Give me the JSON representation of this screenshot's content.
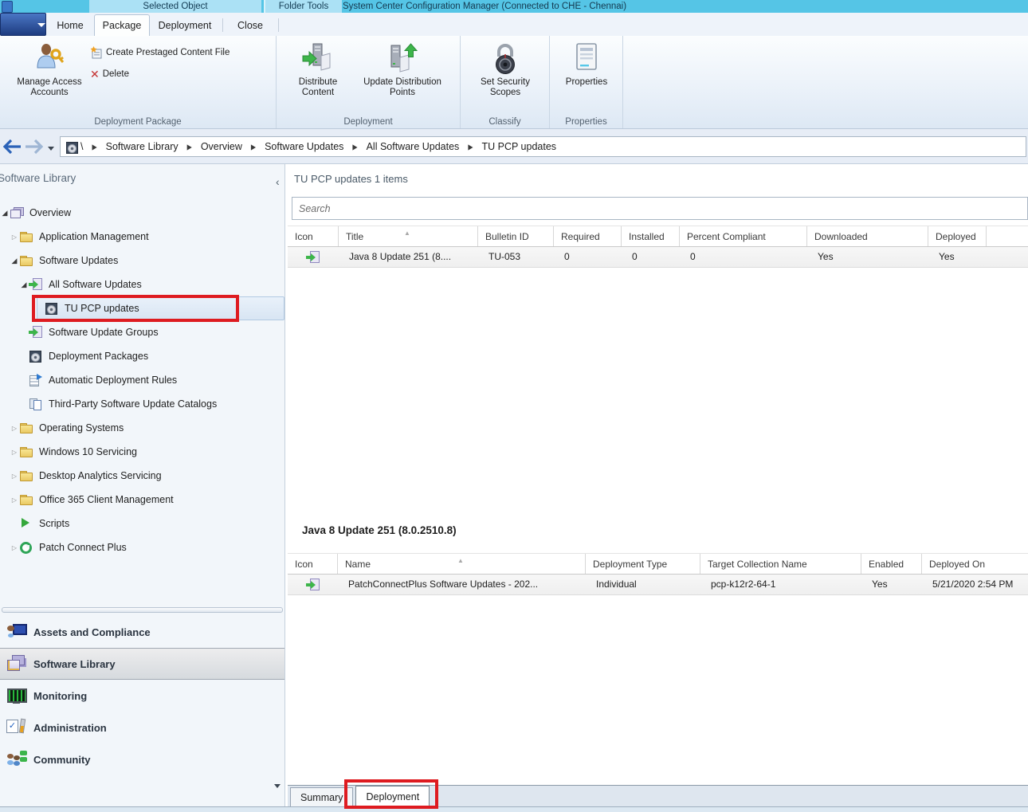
{
  "title_bar": {
    "ctx_groups": [
      "Selected Object",
      "Folder Tools"
    ],
    "title": "System Center Configuration Manager (Connected to CHE - Chennai)"
  },
  "ribbon": {
    "tabs": {
      "home": "Home",
      "package": "Package",
      "deployment": "Deployment",
      "close": "Close"
    },
    "active_tab": "Package",
    "buttons": {
      "manage_access": "Manage Access Accounts",
      "create_prestaged": "Create Prestaged Content File",
      "delete": "Delete",
      "distribute": "Distribute Content",
      "update_dp": "Update Distribution Points",
      "set_security": "Set Security Scopes",
      "properties": "Properties"
    },
    "groups": {
      "deployment_package": "Deployment Package",
      "deployment": "Deployment",
      "classify": "Classify",
      "properties": "Properties"
    }
  },
  "breadcrumb": {
    "root": "\\",
    "items": [
      "Software Library",
      "Overview",
      "Software Updates",
      "All Software Updates",
      "TU PCP updates"
    ]
  },
  "sidebar": {
    "title": "Software Library",
    "tree": [
      {
        "label": "Overview"
      },
      {
        "label": "Application Management"
      },
      {
        "label": "Software Updates"
      },
      {
        "label": "All Software Updates"
      },
      {
        "label": "TU PCP updates"
      },
      {
        "label": "Software Update Groups"
      },
      {
        "label": "Deployment Packages"
      },
      {
        "label": "Automatic Deployment Rules"
      },
      {
        "label": "Third-Party Software Update Catalogs"
      },
      {
        "label": "Operating Systems"
      },
      {
        "label": "Windows 10 Servicing"
      },
      {
        "label": "Desktop Analytics Servicing"
      },
      {
        "label": "Office 365 Client Management"
      },
      {
        "label": "Scripts"
      },
      {
        "label": "Patch Connect Plus"
      }
    ],
    "nav": [
      {
        "label": "Assets and Compliance"
      },
      {
        "label": "Software Library"
      },
      {
        "label": "Monitoring"
      },
      {
        "label": "Administration"
      },
      {
        "label": "Community"
      }
    ],
    "selected_tree_item": "TU PCP updates",
    "selected_nav_item": "Software Library"
  },
  "main": {
    "header": "TU PCP updates 1 items",
    "search_placeholder": "Search",
    "columns": [
      "Icon",
      "Title",
      "Bulletin ID",
      "Required",
      "Installed",
      "Percent Compliant",
      "Downloaded",
      "Deployed"
    ],
    "row": {
      "title": "Java 8 Update 251 (8....",
      "bulletin_id": "TU-053",
      "required": "0",
      "installed": "0",
      "percent_compliant": "0",
      "downloaded": "Yes",
      "deployed": "Yes"
    }
  },
  "detail": {
    "title": "Java 8 Update 251 (8.0.2510.8)",
    "columns": [
      "Icon",
      "Name",
      "Deployment Type",
      "Target Collection Name",
      "Enabled",
      "Deployed On"
    ],
    "row": {
      "name": "PatchConnectPlus Software Updates - 202...",
      "deployment_type": "Individual",
      "target_collection": "pcp-k12r2-64-1",
      "enabled": "Yes",
      "deployed_on": "5/21/2020 2:54 PM"
    },
    "tabs": [
      "Summary",
      "Deployment"
    ],
    "active_tab": "Deployment"
  },
  "annotations": {
    "color": "#de1b20"
  }
}
